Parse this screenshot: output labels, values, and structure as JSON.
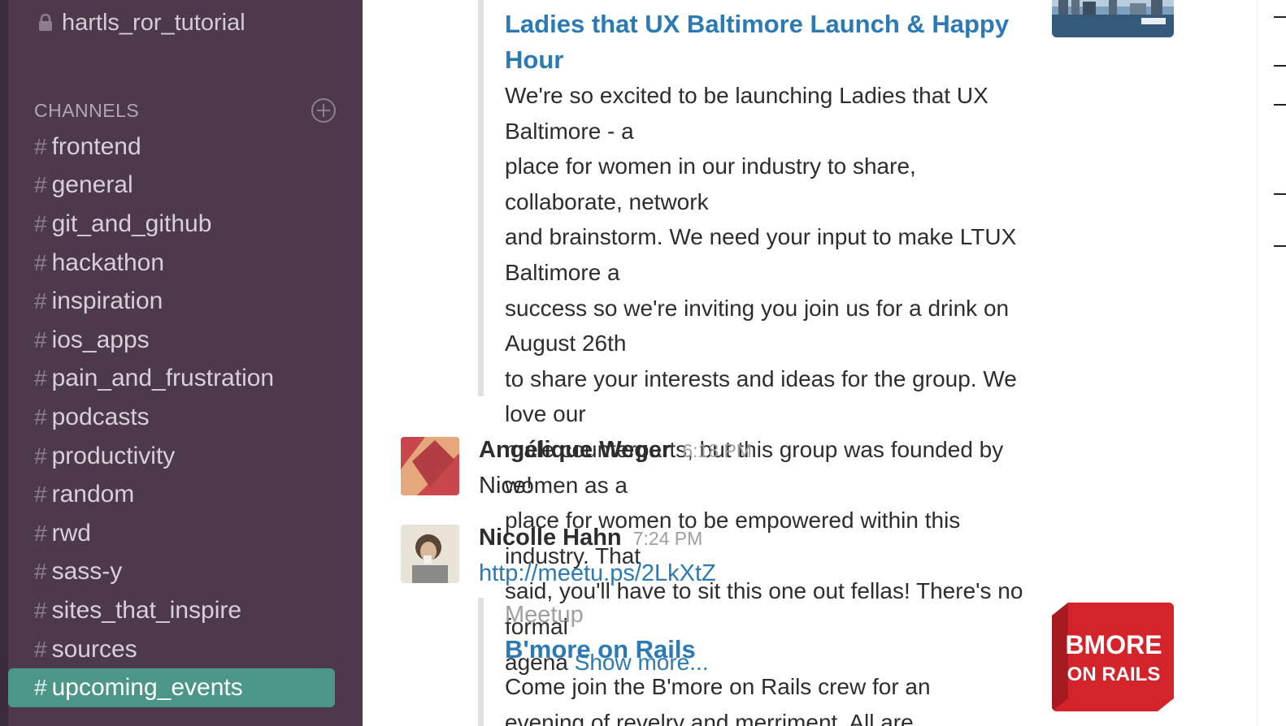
{
  "sidebar": {
    "private_channel": "hartls_ror_tutorial",
    "channels_header": "CHANNELS",
    "channels": [
      {
        "name": "frontend"
      },
      {
        "name": "general"
      },
      {
        "name": "git_and_github"
      },
      {
        "name": "hackathon"
      },
      {
        "name": "inspiration"
      },
      {
        "name": "ios_apps"
      },
      {
        "name": "pain_and_frustration"
      },
      {
        "name": "podcasts"
      },
      {
        "name": "productivity"
      },
      {
        "name": "random"
      },
      {
        "name": "rwd"
      },
      {
        "name": "sass-y"
      },
      {
        "name": "sites_that_inspire"
      },
      {
        "name": "sources"
      },
      {
        "name": "upcoming_events",
        "active": true
      }
    ],
    "hash": "#",
    "accent_color": "#4c9689",
    "background_color": "#4d394b"
  },
  "messages": {
    "attachment1": {
      "title_line1": "Ladies that UX Baltimore Launch & Happy",
      "title_line2": "Hour",
      "body_lines": [
        "We're so excited to be launching Ladies that UX Baltimore - a",
        "place for women in our industry to share, collaborate, network",
        "and brainstorm. We need your input to make LTUX Baltimore a",
        "success so we're inviting you join us for a drink on August 26th",
        "to share your interests and ideas for the group. We love our",
        "male counterparts, but this group was founded by women as a",
        "place for women to be empowered within this industry. That",
        "said, you'll have to sit this one out fellas!  There's no formal"
      ],
      "last_line": "agena ",
      "show_more": "Show more..."
    },
    "message1": {
      "author": "Angélique Weger",
      "time": "6:18 PM",
      "text": "Nice!"
    },
    "message2": {
      "author": "Nicolle Hahn",
      "time": "7:24 PM",
      "link": "http://meetu.ps/2LkXtZ",
      "attachment": {
        "service": "Meetup",
        "title": "B'more on Rails",
        "body_line1": "Come join the B'more on Rails crew for an",
        "body_line2": "evening of revelry and merriment. All are",
        "logo_line1": "BMORE",
        "logo_line2": "ON RAILS"
      }
    }
  }
}
